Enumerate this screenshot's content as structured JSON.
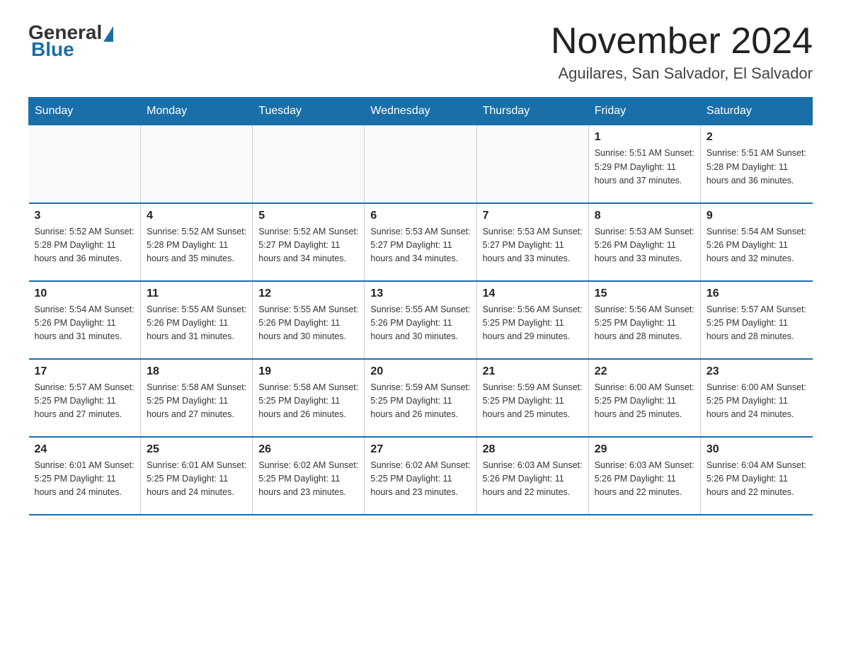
{
  "header": {
    "logo_general": "General",
    "logo_blue": "Blue",
    "month_title": "November 2024",
    "location": "Aguilares, San Salvador, El Salvador"
  },
  "weekdays": [
    "Sunday",
    "Monday",
    "Tuesday",
    "Wednesday",
    "Thursday",
    "Friday",
    "Saturday"
  ],
  "weeks": [
    [
      {
        "day": "",
        "info": ""
      },
      {
        "day": "",
        "info": ""
      },
      {
        "day": "",
        "info": ""
      },
      {
        "day": "",
        "info": ""
      },
      {
        "day": "",
        "info": ""
      },
      {
        "day": "1",
        "info": "Sunrise: 5:51 AM\nSunset: 5:29 PM\nDaylight: 11 hours and 37 minutes."
      },
      {
        "day": "2",
        "info": "Sunrise: 5:51 AM\nSunset: 5:28 PM\nDaylight: 11 hours and 36 minutes."
      }
    ],
    [
      {
        "day": "3",
        "info": "Sunrise: 5:52 AM\nSunset: 5:28 PM\nDaylight: 11 hours and 36 minutes."
      },
      {
        "day": "4",
        "info": "Sunrise: 5:52 AM\nSunset: 5:28 PM\nDaylight: 11 hours and 35 minutes."
      },
      {
        "day": "5",
        "info": "Sunrise: 5:52 AM\nSunset: 5:27 PM\nDaylight: 11 hours and 34 minutes."
      },
      {
        "day": "6",
        "info": "Sunrise: 5:53 AM\nSunset: 5:27 PM\nDaylight: 11 hours and 34 minutes."
      },
      {
        "day": "7",
        "info": "Sunrise: 5:53 AM\nSunset: 5:27 PM\nDaylight: 11 hours and 33 minutes."
      },
      {
        "day": "8",
        "info": "Sunrise: 5:53 AM\nSunset: 5:26 PM\nDaylight: 11 hours and 33 minutes."
      },
      {
        "day": "9",
        "info": "Sunrise: 5:54 AM\nSunset: 5:26 PM\nDaylight: 11 hours and 32 minutes."
      }
    ],
    [
      {
        "day": "10",
        "info": "Sunrise: 5:54 AM\nSunset: 5:26 PM\nDaylight: 11 hours and 31 minutes."
      },
      {
        "day": "11",
        "info": "Sunrise: 5:55 AM\nSunset: 5:26 PM\nDaylight: 11 hours and 31 minutes."
      },
      {
        "day": "12",
        "info": "Sunrise: 5:55 AM\nSunset: 5:26 PM\nDaylight: 11 hours and 30 minutes."
      },
      {
        "day": "13",
        "info": "Sunrise: 5:55 AM\nSunset: 5:26 PM\nDaylight: 11 hours and 30 minutes."
      },
      {
        "day": "14",
        "info": "Sunrise: 5:56 AM\nSunset: 5:25 PM\nDaylight: 11 hours and 29 minutes."
      },
      {
        "day": "15",
        "info": "Sunrise: 5:56 AM\nSunset: 5:25 PM\nDaylight: 11 hours and 28 minutes."
      },
      {
        "day": "16",
        "info": "Sunrise: 5:57 AM\nSunset: 5:25 PM\nDaylight: 11 hours and 28 minutes."
      }
    ],
    [
      {
        "day": "17",
        "info": "Sunrise: 5:57 AM\nSunset: 5:25 PM\nDaylight: 11 hours and 27 minutes."
      },
      {
        "day": "18",
        "info": "Sunrise: 5:58 AM\nSunset: 5:25 PM\nDaylight: 11 hours and 27 minutes."
      },
      {
        "day": "19",
        "info": "Sunrise: 5:58 AM\nSunset: 5:25 PM\nDaylight: 11 hours and 26 minutes."
      },
      {
        "day": "20",
        "info": "Sunrise: 5:59 AM\nSunset: 5:25 PM\nDaylight: 11 hours and 26 minutes."
      },
      {
        "day": "21",
        "info": "Sunrise: 5:59 AM\nSunset: 5:25 PM\nDaylight: 11 hours and 25 minutes."
      },
      {
        "day": "22",
        "info": "Sunrise: 6:00 AM\nSunset: 5:25 PM\nDaylight: 11 hours and 25 minutes."
      },
      {
        "day": "23",
        "info": "Sunrise: 6:00 AM\nSunset: 5:25 PM\nDaylight: 11 hours and 24 minutes."
      }
    ],
    [
      {
        "day": "24",
        "info": "Sunrise: 6:01 AM\nSunset: 5:25 PM\nDaylight: 11 hours and 24 minutes."
      },
      {
        "day": "25",
        "info": "Sunrise: 6:01 AM\nSunset: 5:25 PM\nDaylight: 11 hours and 24 minutes."
      },
      {
        "day": "26",
        "info": "Sunrise: 6:02 AM\nSunset: 5:25 PM\nDaylight: 11 hours and 23 minutes."
      },
      {
        "day": "27",
        "info": "Sunrise: 6:02 AM\nSunset: 5:25 PM\nDaylight: 11 hours and 23 minutes."
      },
      {
        "day": "28",
        "info": "Sunrise: 6:03 AM\nSunset: 5:26 PM\nDaylight: 11 hours and 22 minutes."
      },
      {
        "day": "29",
        "info": "Sunrise: 6:03 AM\nSunset: 5:26 PM\nDaylight: 11 hours and 22 minutes."
      },
      {
        "day": "30",
        "info": "Sunrise: 6:04 AM\nSunset: 5:26 PM\nDaylight: 11 hours and 22 minutes."
      }
    ]
  ]
}
